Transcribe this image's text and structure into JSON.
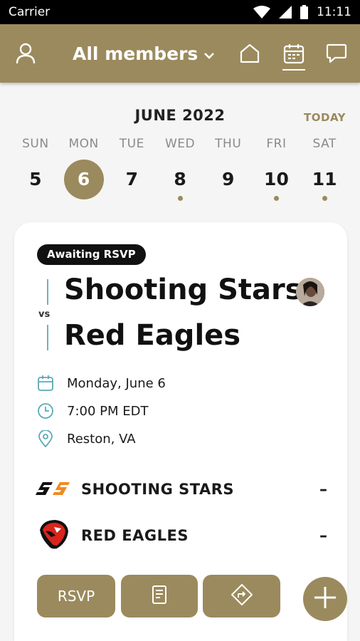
{
  "status_bar": {
    "carrier": "Carrier",
    "time": "11:11"
  },
  "header": {
    "members_label": "All members"
  },
  "calendar": {
    "month": "JUNE 2022",
    "today_label": "TODAY",
    "days": [
      {
        "name": "SUN",
        "num": "5"
      },
      {
        "name": "MON",
        "num": "6"
      },
      {
        "name": "TUE",
        "num": "7"
      },
      {
        "name": "WED",
        "num": "8"
      },
      {
        "name": "THU",
        "num": "9"
      },
      {
        "name": "FRI",
        "num": "10"
      },
      {
        "name": "SAT",
        "num": "11"
      }
    ]
  },
  "event": {
    "status": "Awaiting RSVP",
    "vs_label": "vs",
    "team_home": "Shooting Stars",
    "team_away": "Red Eagles",
    "date": "Monday, June 6",
    "time": "7:00 PM EDT",
    "location": "Reston, VA",
    "teams": [
      {
        "name": "SHOOTING STARS",
        "score": "–"
      },
      {
        "name": "RED EAGLES",
        "score": "–"
      }
    ],
    "rsvp_label": "RSVP"
  },
  "colors": {
    "accent": "#9b8a5d",
    "teal": "#5aaab8",
    "dark": "#111111"
  }
}
